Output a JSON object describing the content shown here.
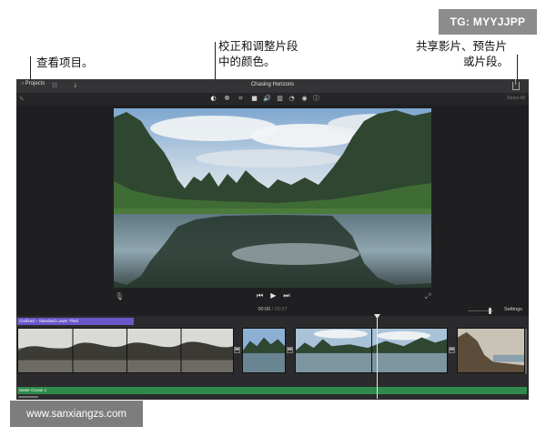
{
  "annotations": {
    "view_projects": "查看项目。",
    "color_correction_line1": "校正和调整片段",
    "color_correction_line2": "中的颜色。",
    "share_line1": "共享影片、预告片",
    "share_line2": "或片段。"
  },
  "watermarks": {
    "telegram": "TG: MYYJJPP",
    "website": "www.sanxiangzs.com"
  },
  "app": {
    "titlebar": {
      "projects_label": "‹ Projects",
      "title": "Chasing Horizons"
    },
    "toolbar": {
      "reset_all": "Reset All",
      "tools": [
        {
          "name": "color-balance-icon",
          "glyph": "◐"
        },
        {
          "name": "color-correction-icon",
          "glyph": "❁"
        },
        {
          "name": "crop-icon",
          "glyph": "⌗"
        },
        {
          "name": "stabilization-icon",
          "glyph": "■"
        },
        {
          "name": "volume-icon",
          "glyph": "🔊"
        },
        {
          "name": "noise-reduction-icon",
          "glyph": "▥"
        },
        {
          "name": "speed-icon",
          "glyph": "◔"
        },
        {
          "name": "clip-filter-icon",
          "glyph": "◉"
        },
        {
          "name": "info-icon",
          "glyph": "ⓘ"
        }
      ]
    },
    "viewer": {
      "timecode_current": "00:06",
      "timecode_separator": " / ",
      "timecode_total": "00:57"
    },
    "timeline": {
      "settings_label": "Settings",
      "title_clip": "Civilized – Standard Lower Third",
      "audio_clip": "Water Ocean 1"
    },
    "colors": {
      "background": "#1f1f21",
      "title_clip": "#6a56c9",
      "audio_clip": "#2f8a4b"
    }
  }
}
